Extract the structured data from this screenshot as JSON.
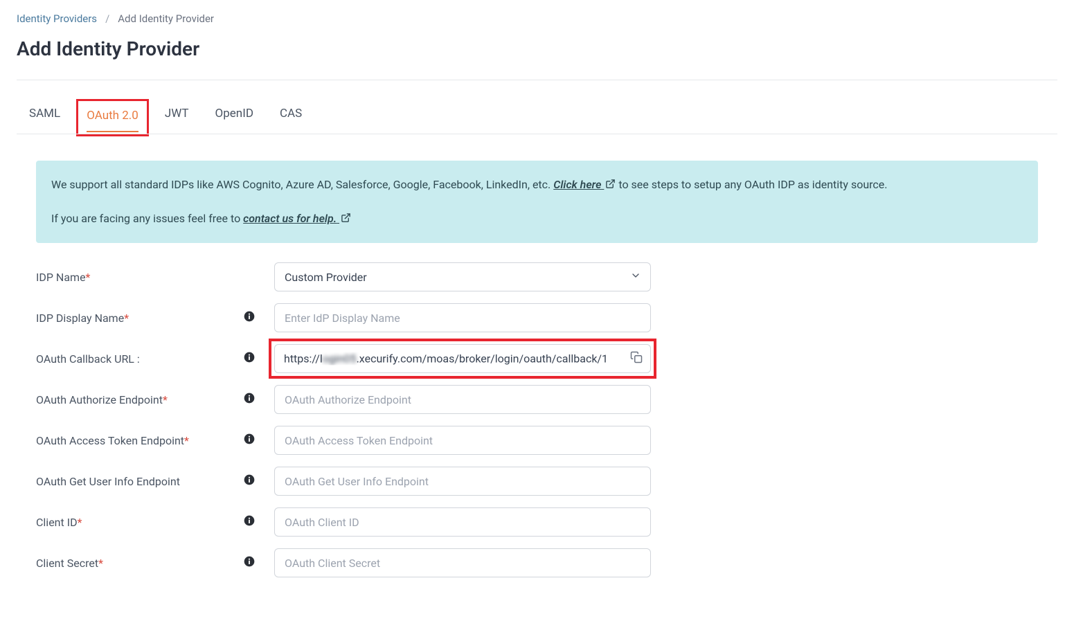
{
  "breadcrumb": {
    "parent": "Identity Providers",
    "separator": "/",
    "current": "Add Identity Provider"
  },
  "page_title": "Add Identity Provider",
  "tabs": [
    {
      "id": "saml",
      "label": "SAML",
      "active": false
    },
    {
      "id": "oauth",
      "label": "OAuth 2.0",
      "active": true
    },
    {
      "id": "jwt",
      "label": "JWT",
      "active": false
    },
    {
      "id": "openid",
      "label": "OpenID",
      "active": false
    },
    {
      "id": "cas",
      "label": "CAS",
      "active": false
    }
  ],
  "info_banner": {
    "line1_prefix": "We support all standard IDPs like AWS Cognito, Azure AD, Salesforce, Google, Facebook, LinkedIn, etc. ",
    "line1_link": "Click here",
    "line1_suffix": " to see steps to setup any OAuth IDP as identity source.",
    "line2_prefix": "If you are facing any issues feel free to ",
    "line2_link": "contact us for help."
  },
  "form": {
    "idp_name": {
      "label": "IDP Name",
      "selected": "Custom Provider"
    },
    "idp_display_name": {
      "label": "IDP Display Name",
      "placeholder": "Enter IdP Display Name"
    },
    "callback_url": {
      "label": "OAuth Callback URL :",
      "value_prefix": "https://l",
      "value_blurred": "ogin05",
      "value_suffix": ".xecurify.com/moas/broker/login/oauth/callback/1"
    },
    "authorize_endpoint": {
      "label": "OAuth Authorize Endpoint",
      "placeholder": "OAuth Authorize Endpoint"
    },
    "access_token_endpoint": {
      "label": "OAuth Access Token Endpoint",
      "placeholder": "OAuth Access Token Endpoint"
    },
    "user_info_endpoint": {
      "label": "OAuth Get User Info Endpoint",
      "placeholder": "OAuth Get User Info Endpoint"
    },
    "client_id": {
      "label": "Client ID",
      "placeholder": "OAuth Client ID"
    },
    "client_secret": {
      "label": "Client Secret",
      "placeholder": "OAuth Client Secret"
    }
  }
}
